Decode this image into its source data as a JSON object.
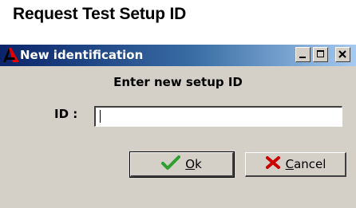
{
  "page": {
    "heading": "Request Test Setup ID"
  },
  "window": {
    "title": "New identification",
    "controls": {
      "minimize": "minimize-icon",
      "maximize": "maximize-icon",
      "close": "close-icon"
    }
  },
  "form": {
    "prompt": "Enter new setup ID",
    "id_label": "ID :",
    "id_value": ""
  },
  "buttons": {
    "ok": {
      "mnemonic": "O",
      "rest": "k"
    },
    "cancel": {
      "mnemonic": "C",
      "rest": "ancel"
    }
  },
  "colors": {
    "titlebar_start": "#0a246a",
    "titlebar_end": "#a6caf0",
    "dialog_bg": "#d4d0c8",
    "check_green": "#2e9e2e",
    "cross_red": "#cc0000"
  }
}
